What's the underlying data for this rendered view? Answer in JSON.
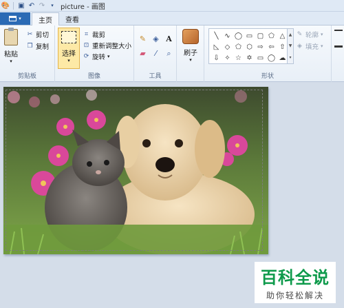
{
  "window": {
    "title": "picture - 画图"
  },
  "tabs": {
    "home": "主页",
    "view": "查看"
  },
  "clipboard": {
    "paste": "粘贴",
    "cut": "剪切",
    "copy": "复制",
    "group": "剪贴板"
  },
  "image": {
    "select": "选择",
    "crop": "裁剪",
    "resize": "重新调整大小",
    "rotate": "旋转",
    "group": "图像"
  },
  "tools": {
    "group": "工具"
  },
  "brushes": {
    "label": "刷子"
  },
  "shapes": {
    "outline": "轮廓",
    "fill": "填充",
    "group": "形状"
  },
  "watermark": {
    "main": "百科全说",
    "sub": "助你轻松解决"
  },
  "colors": {
    "accent": "#2b6bb5",
    "select_highlight": "#fde9a6",
    "watermark_green": "#0e9a4b"
  }
}
